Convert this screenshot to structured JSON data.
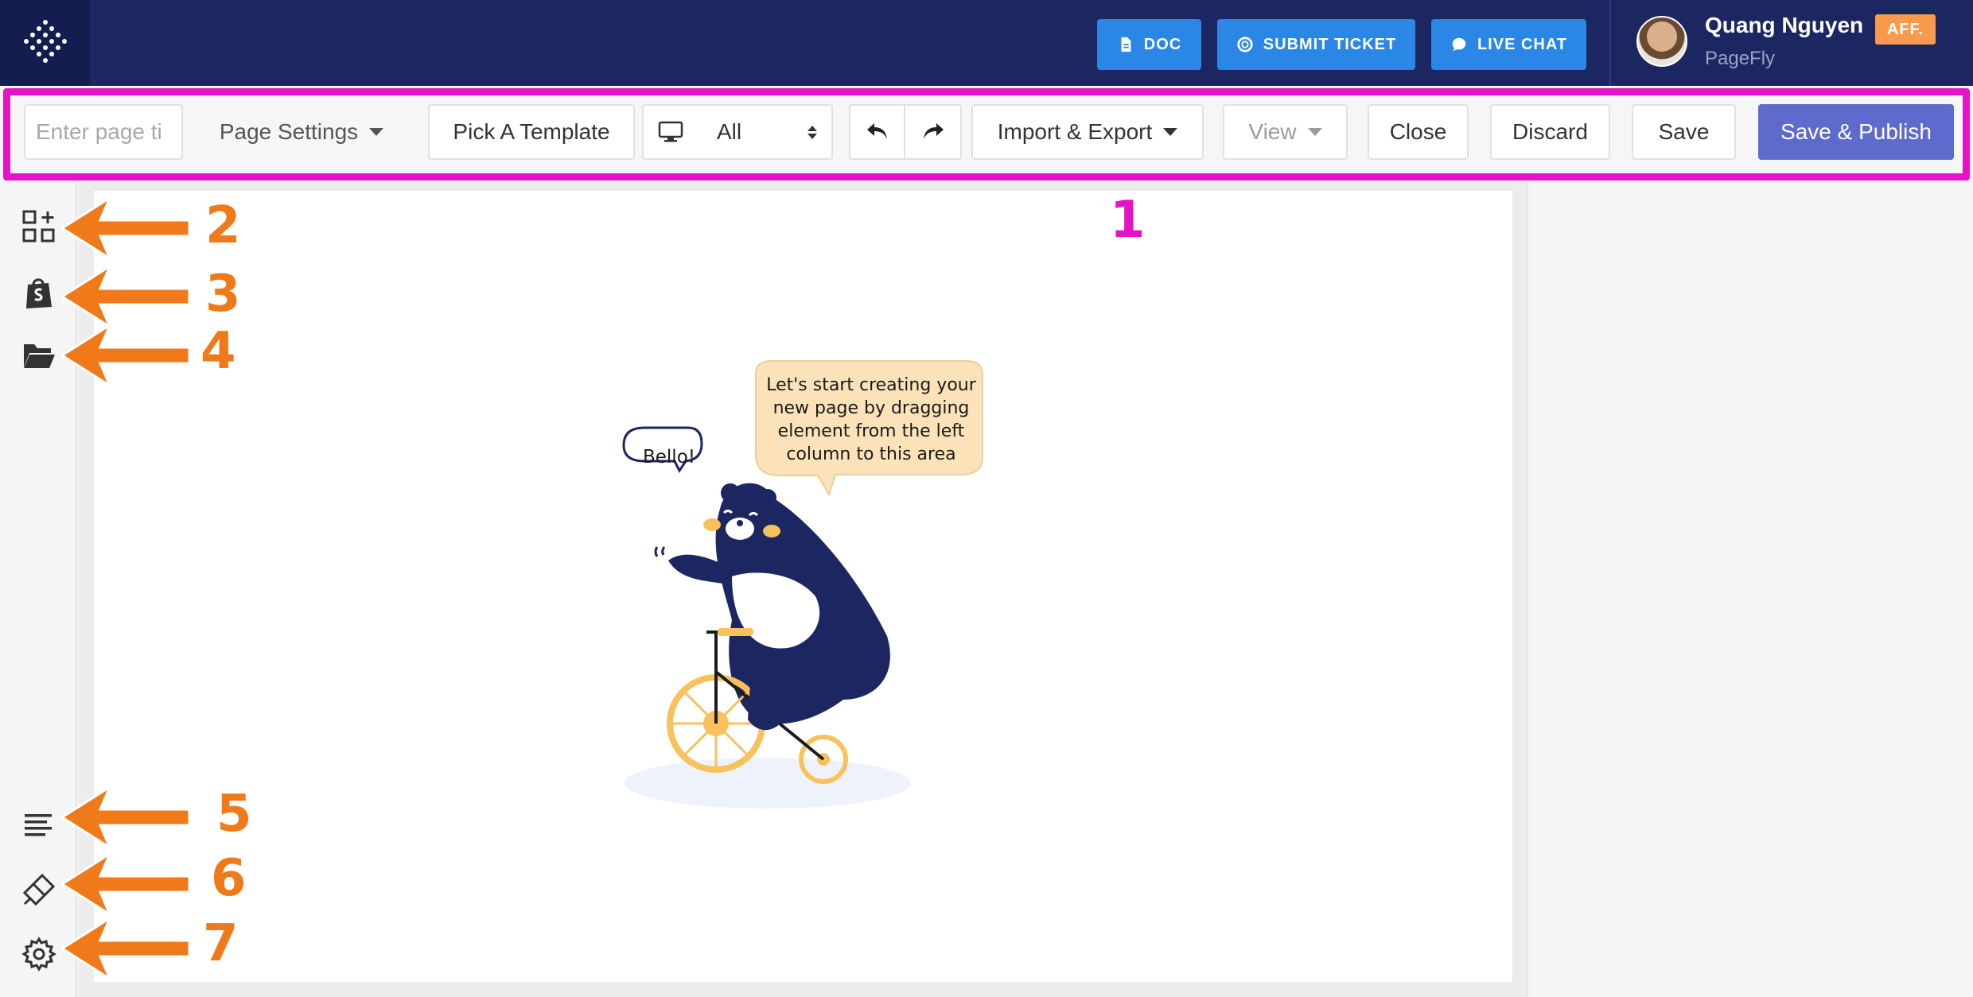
{
  "header": {
    "doc_label": "DOC",
    "ticket_label": "SUBMIT TICKET",
    "chat_label": "LIVE CHAT",
    "user_name": "Quang Nguyen",
    "user_badge": "AFF.",
    "user_company": "PageFly",
    "button_color": "#2b87e6",
    "bg_color": "#1c2762"
  },
  "toolbar": {
    "title_placeholder": "Enter page ti",
    "page_settings_label": "Page Settings",
    "template_label": "Pick A Template",
    "device_value": "All",
    "import_export_label": "Import & Export",
    "view_label": "View",
    "close_label": "Close",
    "discard_label": "Discard",
    "save_label": "Save",
    "publish_label": "Save & Publish",
    "publish_color": "#5f6bcc"
  },
  "sidebar": {
    "icons": [
      "add-element-icon",
      "shopify-bag-icon",
      "folder-open-icon",
      "align-left-icon",
      "eraser-icon",
      "gear-icon"
    ]
  },
  "canvas": {
    "hello_bubble": "Bello!",
    "hint_line1": "Let's start creating your",
    "hint_line2": "new page by dragging",
    "hint_line3": "element from the left",
    "hint_line4": "column to this area"
  },
  "annotations": {
    "n1": "1",
    "n2": "2",
    "n3": "3",
    "n4": "4",
    "n5": "5",
    "n6": "6",
    "n7": "7",
    "highlight_color": "#e413c8",
    "arrow_color": "#f07a1a"
  }
}
